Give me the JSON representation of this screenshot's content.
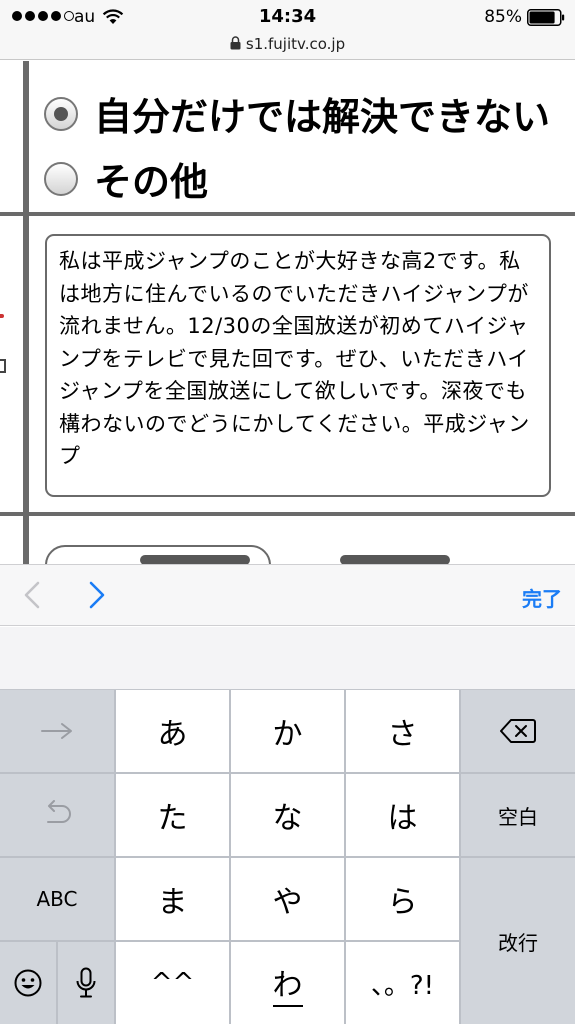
{
  "status_bar": {
    "carrier": "au",
    "time": "14:34",
    "battery_percent": "85%",
    "battery_level": 0.85
  },
  "url_bar": {
    "url": "s1.fujitv.co.jp"
  },
  "form": {
    "radio_options": [
      {
        "label": "自分だけでは解決できない",
        "checked": true
      },
      {
        "label": "その他",
        "checked": false
      }
    ],
    "message_text": "私は平成ジャンプのことが大好きな高2です。私は地方に住んでいるのでいただきハイジャンプが流れません。12/30の全国放送が初めてハイジャンプをテレビで見た回です。ぜひ、いただきハイジャンプを全国放送にして欲しいです。深夜でも構わないのでどうにかしてください。平成ジャンプ"
  },
  "accessory_bar": {
    "done_label": "完了"
  },
  "keyboard": {
    "rows": [
      [
        "あ",
        "か",
        "さ"
      ],
      [
        "た",
        "な",
        "は"
      ],
      [
        "ま",
        "や",
        "ら"
      ],
      [
        "^^",
        "わ",
        "、。?!"
      ]
    ],
    "space_label": "空白",
    "abc_label": "ABC",
    "return_label": "改行"
  },
  "colors": {
    "accent": "#1a7cf5",
    "keyboard_bg": "#bcc0c7",
    "function_key": "#d1d5db",
    "table_border": "#6a6a6a"
  },
  "icons": {
    "status": [
      "signal-dots-icon",
      "wifi-icon",
      "battery-icon"
    ],
    "url": "lock-icon",
    "nav": [
      "chevron-left-icon",
      "chevron-right-icon"
    ],
    "keyboard": [
      "arrow-right-icon",
      "undo-icon",
      "backspace-icon",
      "emoji-icon",
      "microphone-icon"
    ]
  }
}
